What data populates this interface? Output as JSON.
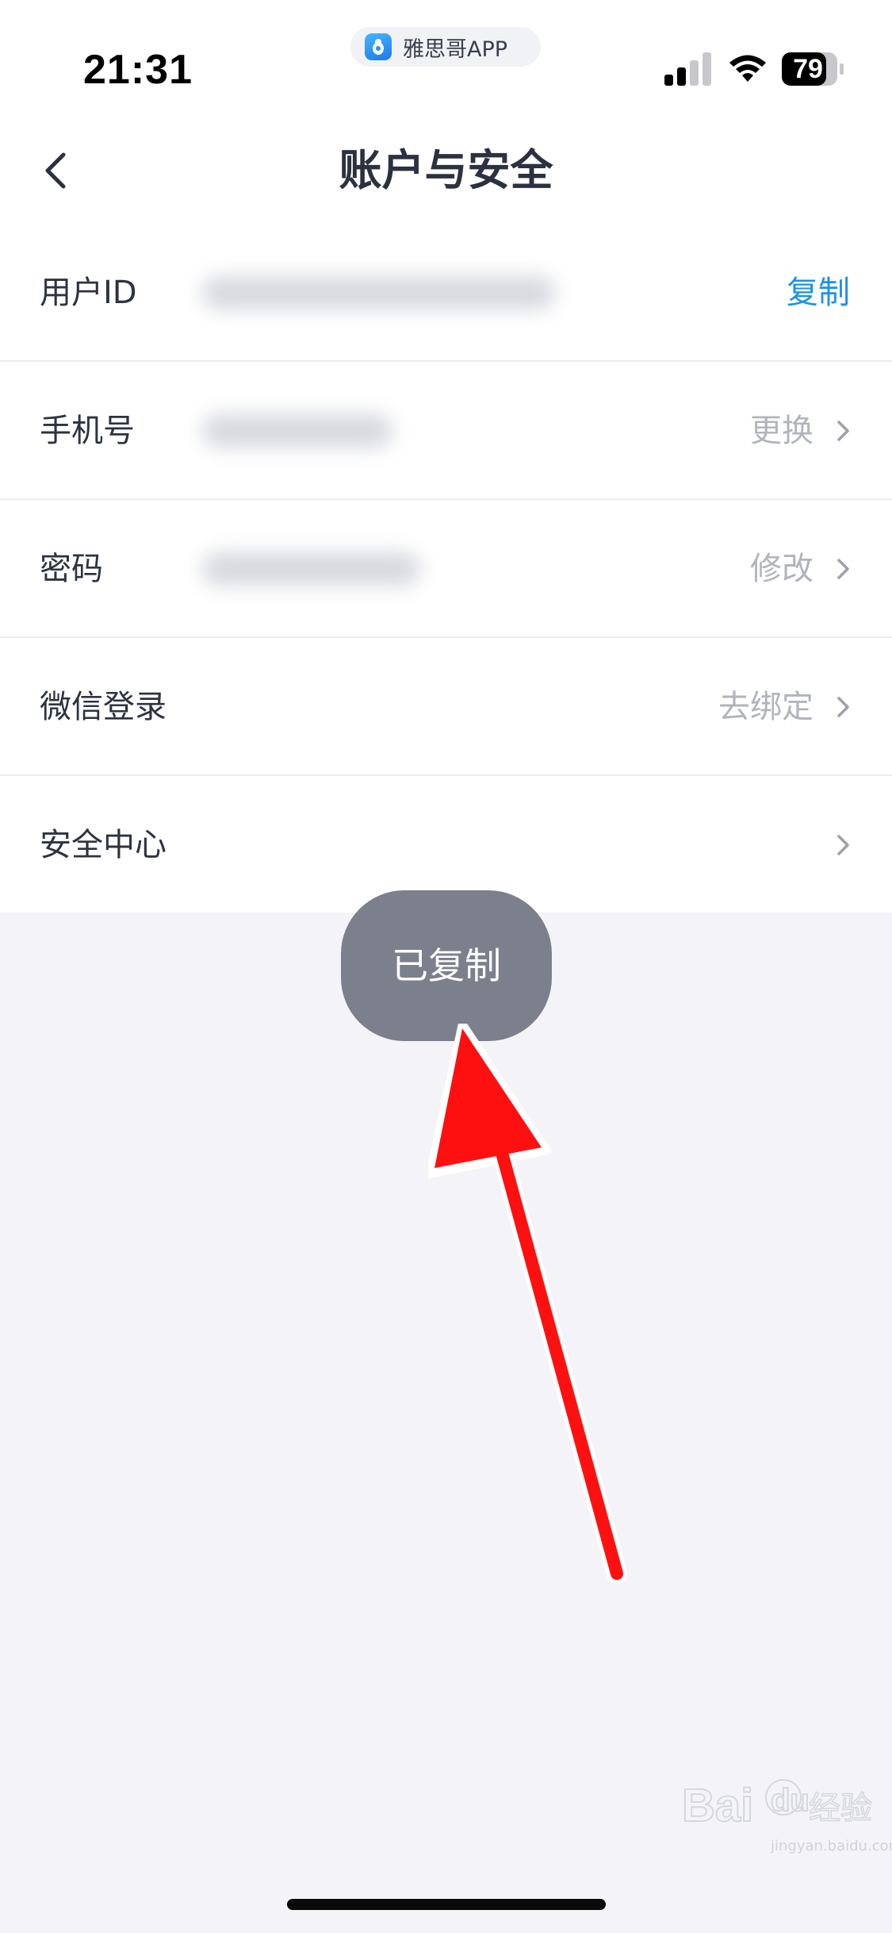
{
  "status_bar": {
    "time": "21:31",
    "app_name": "雅思哥APP",
    "battery": "79"
  },
  "nav": {
    "title": "账户与安全",
    "back_icon": "chevron-left-icon"
  },
  "rows": [
    {
      "label": "用户ID",
      "action": "复制",
      "action_color": "#1e91e6",
      "has_chevron": false
    },
    {
      "label": "手机号",
      "action": "更换",
      "has_chevron": true
    },
    {
      "label": "密码",
      "action": "修改",
      "has_chevron": true
    },
    {
      "label": "微信登录",
      "action": "去绑定",
      "has_chevron": true
    },
    {
      "label": "安全中心",
      "action": "",
      "has_chevron": true
    }
  ],
  "toast": {
    "text": "已复制"
  },
  "colors": {
    "accent": "#1e91e6",
    "background": "#f4f4f8",
    "toast_bg": "#7c808c",
    "arrow": "#ff1010"
  },
  "watermark": {
    "logo": "Baidu经验",
    "url": "jingyan.baidu.com"
  }
}
